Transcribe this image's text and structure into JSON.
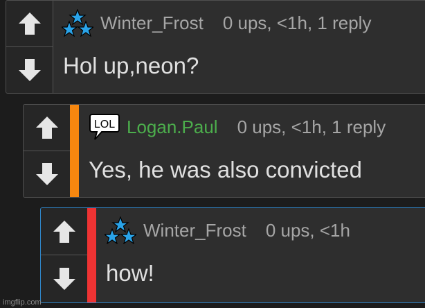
{
  "comments": [
    {
      "username": "Winter_Frost",
      "meta": "0 ups, <1h, 1 reply",
      "text": "Hol up,neon?",
      "badge_icon": "three-stars-icon"
    },
    {
      "username": "Logan.Paul",
      "meta": "0 ups, <1h, 1 reply",
      "text": "Yes, he was also convicted",
      "badge_icon": "lol-speech-bubble-icon",
      "badge_text": "LOL",
      "username_color": "#4cae4c",
      "stripe_color": "#f7870f"
    },
    {
      "username": "Winter_Frost",
      "meta": "0 ups, <1h",
      "text": "how!",
      "badge_icon": "three-stars-icon",
      "stripe_color": "#ee3333",
      "highlight_border": "#2f86c9"
    }
  ],
  "watermark": "imgflip.com",
  "icons": {
    "upvote": "arrow-up-icon",
    "downvote": "arrow-down-icon"
  },
  "colors": {
    "star": "#2aa3e8",
    "arrow": "#e6e6e6"
  }
}
